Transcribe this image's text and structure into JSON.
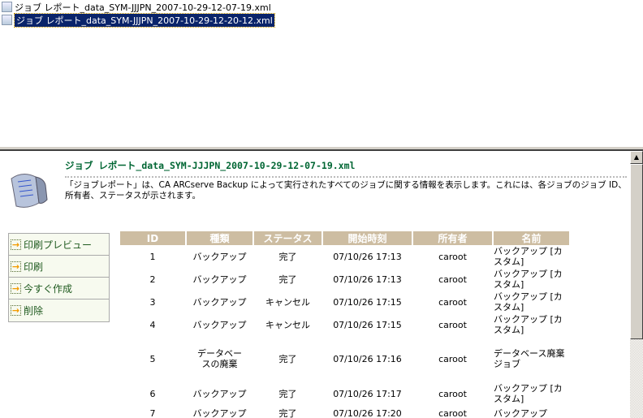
{
  "files": [
    {
      "name": "ジョブ レポート_data_SYM-JJJPN_2007-10-29-12-07-19.xml",
      "selected": false
    },
    {
      "name": "ジョブ レポート_data_SYM-JJJPN_2007-10-29-12-20-12.xml",
      "selected": true
    }
  ],
  "report": {
    "title": "ジョブ レポート_data_SYM-JJJPN_2007-10-29-12-07-19.xml",
    "description": "「ジョブレポート」は、CA ARCserve Backup によって実行されたすべてのジョブに関する情報を表示します。これには、各ジョブのジョブ ID、所有者、ステータスが示されます。"
  },
  "menu": [
    "印刷プレビュー",
    "印刷",
    "今すぐ作成",
    "削除"
  ],
  "table": {
    "headers": [
      "ID",
      "種類",
      "ステータス",
      "開始時刻",
      "所有者",
      "名前"
    ],
    "rows": [
      [
        "1",
        "バックアップ",
        "完了",
        "07/10/26 17:13",
        "caroot",
        "バックアップ [カスタム]"
      ],
      [
        "2",
        "バックアップ",
        "完了",
        "07/10/26 17:13",
        "caroot",
        "バックアップ [カスタム]"
      ],
      [
        "3",
        "バックアップ",
        "キャンセル",
        "07/10/26 17:15",
        "caroot",
        "バックアップ [カスタム]"
      ],
      [
        "4",
        "バックアップ",
        "キャンセル",
        "07/10/26 17:15",
        "caroot",
        "バックアップ [カスタム]"
      ],
      [
        "5",
        "データベースの廃棄",
        "完了",
        "07/10/26 17:16",
        "caroot",
        "データベース廃棄ジョブ"
      ],
      [
        "6",
        "バックアップ",
        "完了",
        "07/10/26 17:17",
        "caroot",
        "バックアップ [カスタム]"
      ],
      [
        "7",
        "バックアップ",
        "完了",
        "07/10/26 17:20",
        "caroot",
        "バックアップ"
      ]
    ]
  }
}
